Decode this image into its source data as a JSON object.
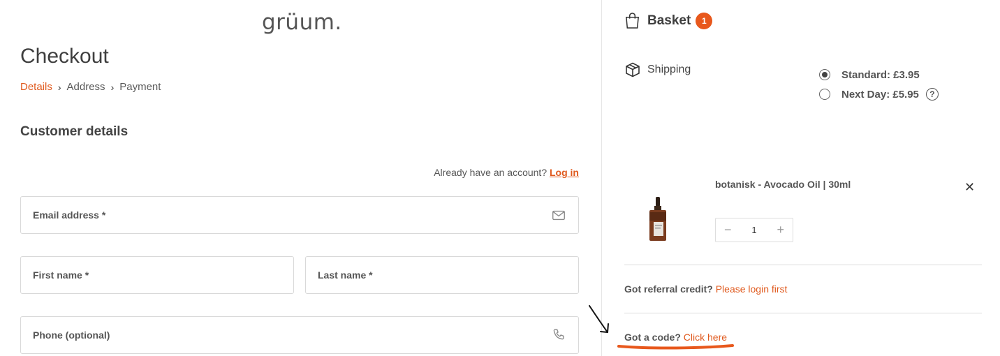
{
  "logo": {
    "text": "grüum."
  },
  "page": {
    "title": "Checkout"
  },
  "breadcrumb": {
    "items": [
      "Details",
      "Address",
      "Payment"
    ],
    "active_index": 0
  },
  "customer": {
    "section_title": "Customer details",
    "account_prompt": "Already have an account?",
    "login_link": "Log in",
    "fields": {
      "email": "Email address *",
      "first_name": "First name *",
      "last_name": "Last name *",
      "phone": "Phone (optional)"
    }
  },
  "basket": {
    "title": "Basket",
    "count": "1",
    "shipping": {
      "label": "Shipping",
      "options": [
        {
          "label": "Standard: £3.95",
          "selected": true
        },
        {
          "label": "Next Day: £5.95",
          "selected": false,
          "help": "?"
        }
      ]
    },
    "items": [
      {
        "name": "botanisk - Avocado Oil | 30ml",
        "quantity": "1"
      }
    ],
    "referral": {
      "question": "Got referral credit?",
      "link": "Please login first"
    },
    "code": {
      "question": "Got a code?",
      "link": "Click here"
    }
  },
  "colors": {
    "accent": "#e05a1e",
    "badge": "#e8581c",
    "annotation_underline": "#e8581c"
  }
}
